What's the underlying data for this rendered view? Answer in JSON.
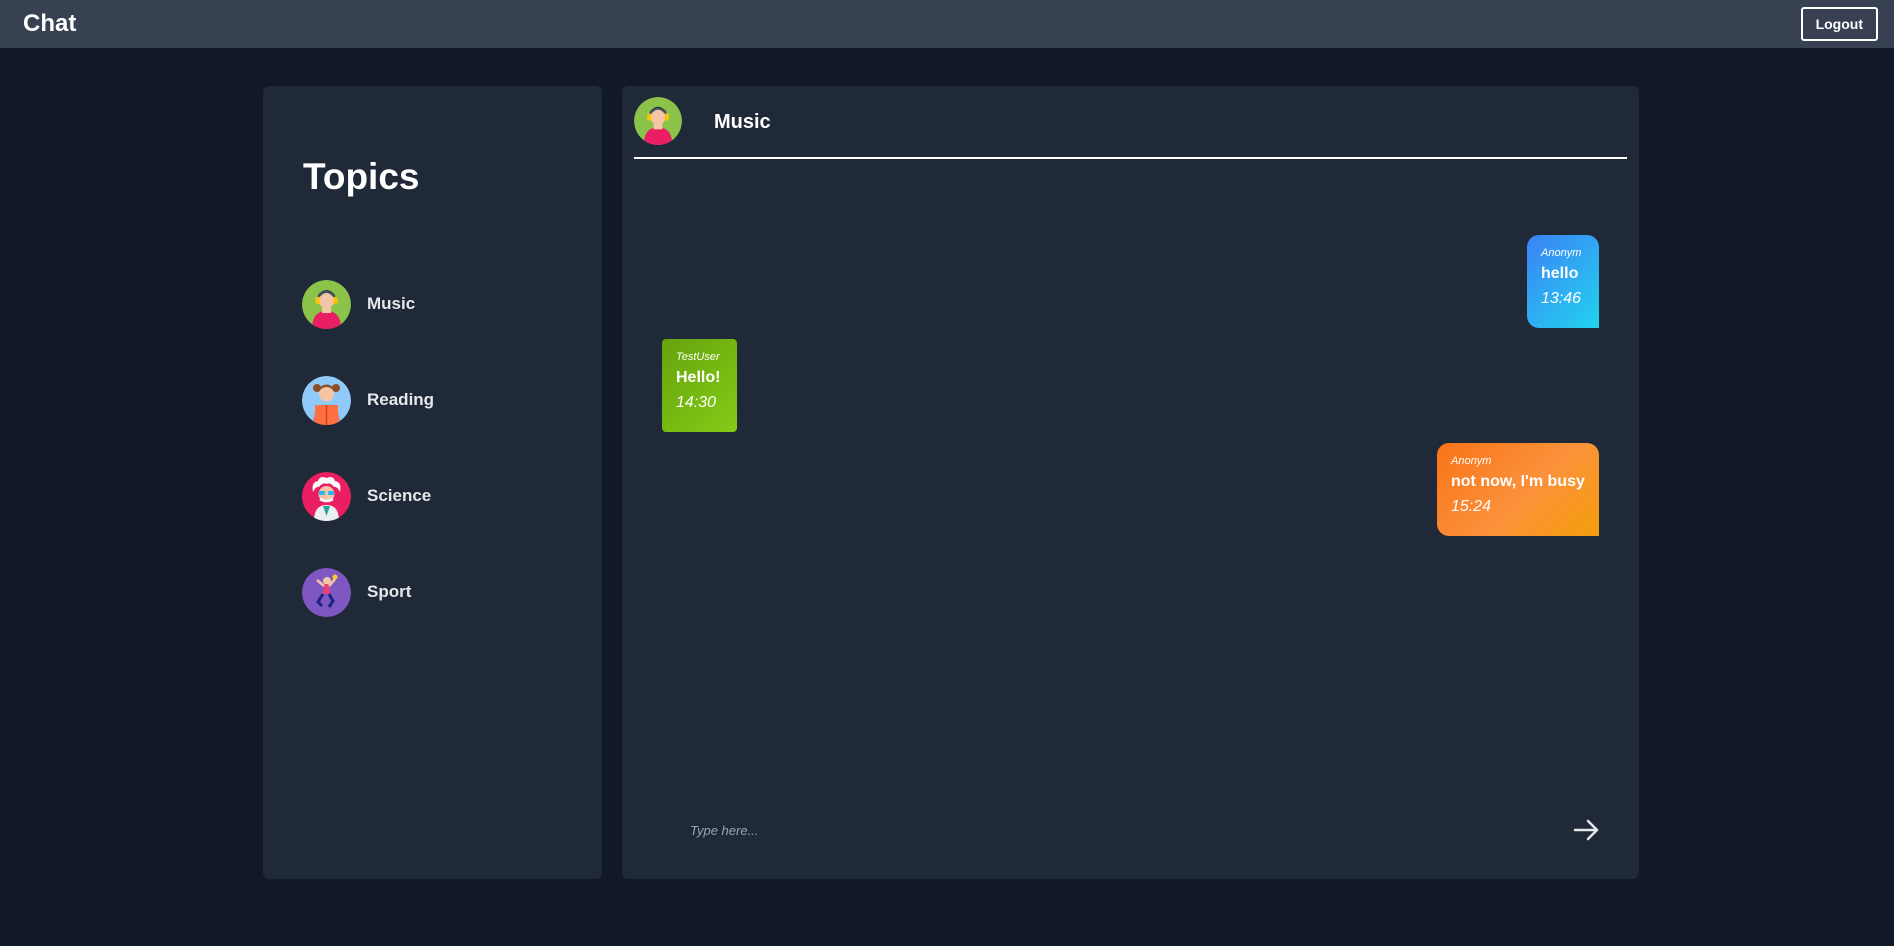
{
  "app": {
    "title": "Chat",
    "logout_label": "Logout"
  },
  "sidebar": {
    "title": "Topics",
    "items": [
      {
        "label": "Music",
        "icon": "music-avatar-icon"
      },
      {
        "label": "Reading",
        "icon": "reading-avatar-icon"
      },
      {
        "label": "Science",
        "icon": "science-avatar-icon"
      },
      {
        "label": "Sport",
        "icon": "sport-avatar-icon"
      }
    ]
  },
  "chat": {
    "title": "Music",
    "messages": [
      {
        "author": "Anonym",
        "text": "hello",
        "time": "13:46",
        "side": "right",
        "color": "#3b82f6"
      },
      {
        "author": "TestUser",
        "text": "Hello!",
        "time": "14:30",
        "side": "left",
        "color": "#65a30d"
      },
      {
        "author": "Anonym",
        "text": "not now, I'm busy",
        "time": "15:24",
        "side": "right",
        "color": "#f97316"
      }
    ],
    "input_placeholder": "Type here...",
    "send_icon": "arrow-right-icon"
  },
  "colors": {
    "background": "#111827",
    "panel": "#1f2937",
    "topbar": "#374151"
  }
}
